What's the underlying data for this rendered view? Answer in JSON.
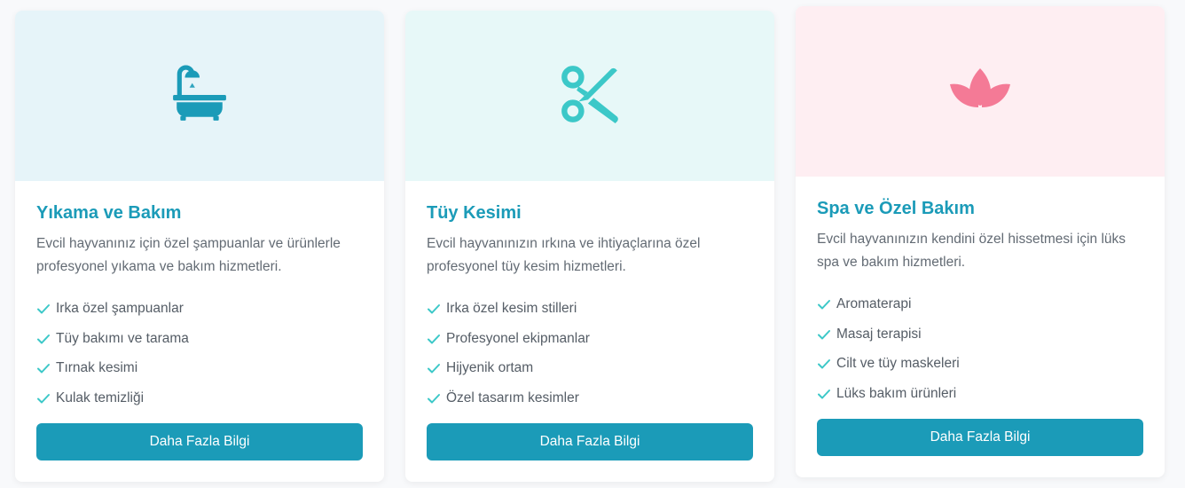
{
  "colors": {
    "accent": "#1b9bb8",
    "teal": "#3cc8c8",
    "pink": "#f47a96"
  },
  "cards": [
    {
      "icon": "bathtub-icon",
      "title": "Yıkama ve Bakım",
      "description": "Evcil hayvanınız için özel şampuanlar ve ürünlerle profesyonel yıkama ve bakım hizmetleri.",
      "features": [
        "Irka özel şampuanlar",
        "Tüy bakımı ve tarama",
        "Tırnak kesimi",
        "Kulak temizliği"
      ],
      "button": "Daha Fazla Bilgi"
    },
    {
      "icon": "scissors-icon",
      "title": "Tüy Kesimi",
      "description": "Evcil hayvanınızın ırkına ve ihtiyaçlarına özel profesyonel tüy kesim hizmetleri.",
      "features": [
        "Irka özel kesim stilleri",
        "Profesyonel ekipmanlar",
        "Hijyenik ortam",
        "Özel tasarım kesimler"
      ],
      "button": "Daha Fazla Bilgi"
    },
    {
      "icon": "lotus-icon",
      "title": "Spa ve Özel Bakım",
      "description": "Evcil hayvanınızın kendini özel hissetmesi için lüks spa ve bakım hizmetleri.",
      "features": [
        "Aromaterapi",
        "Masaj terapisi",
        "Cilt ve tüy maskeleri",
        "Lüks bakım ürünleri"
      ],
      "button": "Daha Fazla Bilgi"
    }
  ]
}
